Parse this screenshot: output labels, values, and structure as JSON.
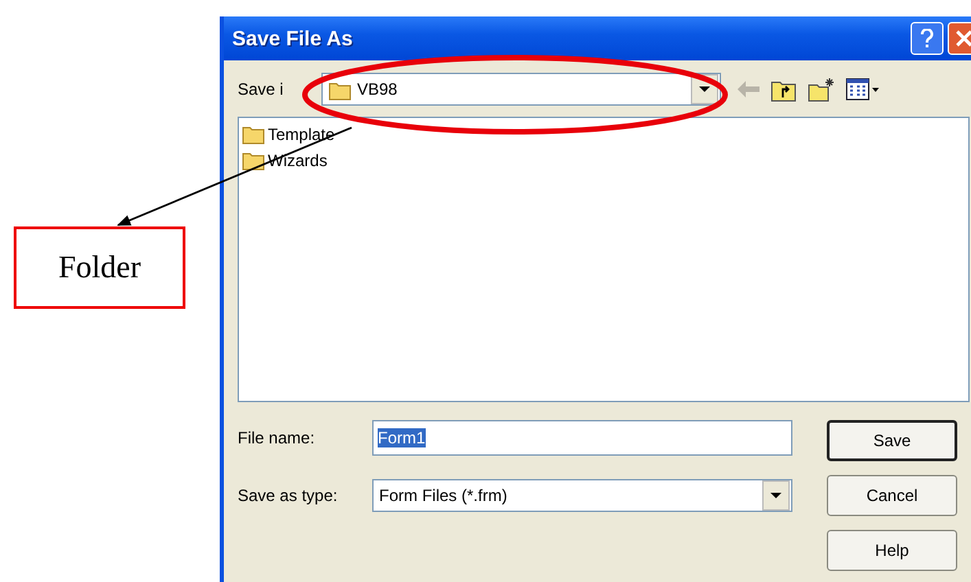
{
  "annotation": {
    "label": "Folder"
  },
  "dialog": {
    "title": "Save File As",
    "save_in": {
      "label": "Save i",
      "value": "VB98"
    },
    "files": [
      {
        "name": "Template"
      },
      {
        "name": "Wizards"
      }
    ],
    "file_name": {
      "label": "File name:",
      "value": "Form1",
      "text_selected": true
    },
    "save_as_type": {
      "label": "Save as type:",
      "value": "Form Files (*.frm)"
    },
    "buttons": [
      {
        "label": "Save",
        "default": true
      },
      {
        "label": "Cancel",
        "default": false
      },
      {
        "label": "Help",
        "default": false
      }
    ]
  }
}
